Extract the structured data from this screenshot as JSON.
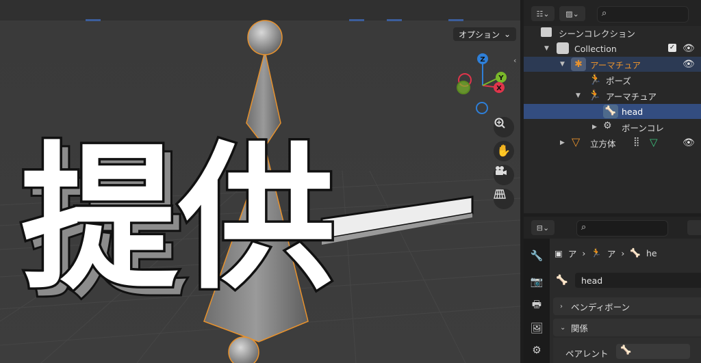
{
  "viewport": {
    "options_label": "オプション",
    "axes": {
      "z": "Z",
      "x": "X",
      "y": "Y"
    },
    "nav_icons": [
      "zoom-icon",
      "hand-pan-icon",
      "camera-icon",
      "grid-icon"
    ],
    "overlay_text": "提供"
  },
  "outliner": {
    "items": [
      {
        "label": "シーンコレクション"
      },
      {
        "label": "Collection"
      },
      {
        "label": "アーマチュア"
      },
      {
        "label": "ポーズ"
      },
      {
        "label": "アーマチュア"
      },
      {
        "label": "head"
      },
      {
        "label": "ボーンコレ"
      },
      {
        "label": "立方体"
      }
    ]
  },
  "properties": {
    "breadcrumb": [
      "ア",
      "ア",
      "he"
    ],
    "name_value": "head",
    "panels": [
      {
        "label": "ベンディボーン"
      },
      {
        "label": "関係"
      }
    ],
    "parent_label": "ペアレント"
  },
  "colors": {
    "accent_orange": "#e8922d",
    "selected_row": "#334d80",
    "active_row": "#2c3a54",
    "axis_x": "#e0354b",
    "axis_y": "#7ab82a",
    "axis_z": "#2e7fd8"
  }
}
